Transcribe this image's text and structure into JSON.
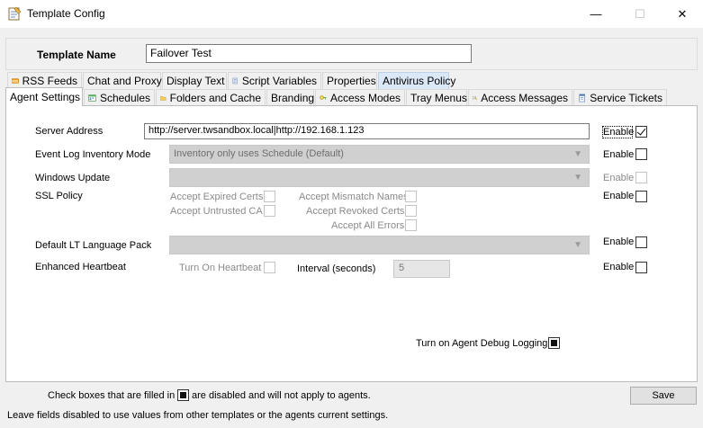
{
  "window": {
    "title": "Template Config",
    "minimize": "—",
    "maximize": "☐",
    "close": "✕"
  },
  "template_name": {
    "label": "Template Name",
    "value": "Failover Test"
  },
  "tabs_row1": [
    {
      "label": "RSS Feeds",
      "icon": "rss-icon"
    },
    {
      "label": "Chat and Proxy"
    },
    {
      "label": "Display Text"
    },
    {
      "label": "Script Variables",
      "icon": "script-icon"
    },
    {
      "label": "Properties"
    },
    {
      "label": "Antivirus Policy"
    }
  ],
  "tabs_row2": [
    {
      "label": "Agent Settings"
    },
    {
      "label": "Schedules",
      "icon": "schedule-icon"
    },
    {
      "label": "Folders and Cache",
      "icon": "folder-icon"
    },
    {
      "label": "Branding"
    },
    {
      "label": "Access Modes",
      "icon": "access-modes-icon"
    },
    {
      "label": "Tray Menus"
    },
    {
      "label": "Access Messages",
      "icon": "message-icon"
    },
    {
      "label": "Service Tickets",
      "icon": "ticket-icon"
    }
  ],
  "form": {
    "server_address": {
      "label": "Server Address",
      "value": "http://server.twsandbox.local|http://192.168.1.123",
      "enable_label": "Enable",
      "enabled": true
    },
    "event_log": {
      "label": "Event Log Inventory Mode",
      "value": "Inventory only uses Schedule (Default)",
      "enable_label": "Enable",
      "enabled": false
    },
    "windows_update": {
      "label": "Windows Update",
      "value": "",
      "enable_label": "Enable",
      "enabled": false
    },
    "ssl_policy": {
      "label": "SSL Policy",
      "enable_label": "Enable",
      "enabled": false,
      "accept_expired": "Accept Expired Certs",
      "accept_untrusted": "Accept Untrusted CA",
      "accept_mismatch": "Accept Mismatch Names",
      "accept_revoked": "Accept Revoked Certs",
      "accept_all": "Accept All Errors"
    },
    "language_pack": {
      "label": "Default LT Language Pack",
      "value": "",
      "enable_label": "Enable",
      "enabled": false
    },
    "heartbeat": {
      "label": "Enhanced Heartbeat",
      "turn_on": "Turn On Heartbeat",
      "interval_label": "Interval (seconds)",
      "interval_value": "5",
      "enable_label": "Enable",
      "enabled": false
    },
    "debug_logging": {
      "label": "Turn on Agent Debug Logging",
      "filled": true
    }
  },
  "footer": {
    "legend_before": "Check boxes that are filled in",
    "legend_after": "are disabled and will not apply to agents.",
    "save_label": "Save",
    "status": "Leave fields disabled to use values from other templates or the agents current settings."
  }
}
